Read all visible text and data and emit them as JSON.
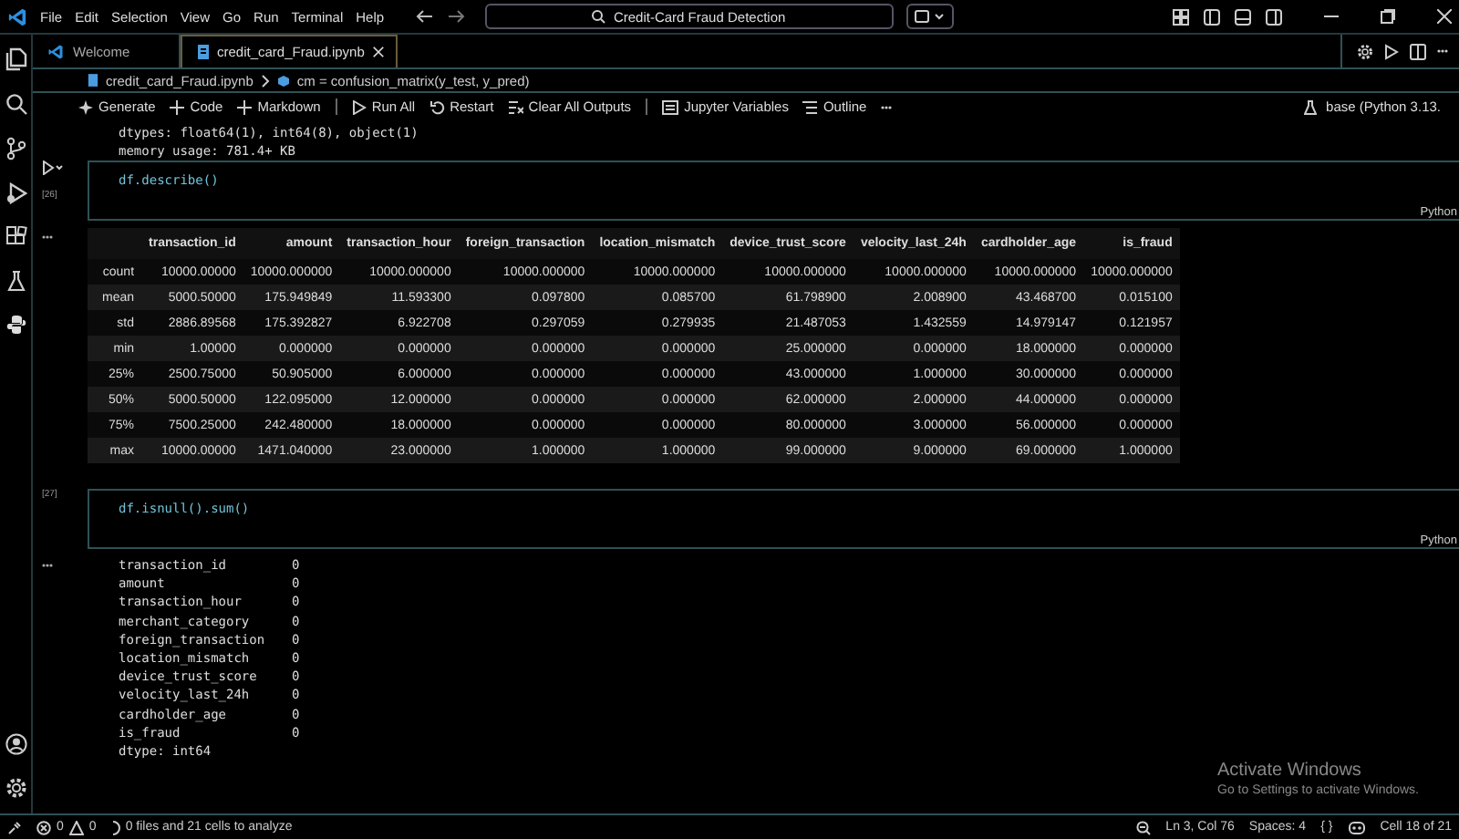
{
  "title_bar": {
    "menus": [
      "File",
      "Edit",
      "Selection",
      "View",
      "Go",
      "Run",
      "Terminal",
      "Help"
    ],
    "search": "Credit-Card Fraud Detection"
  },
  "tabs": [
    {
      "label": "Welcome",
      "kind": "welcome",
      "selected": false
    },
    {
      "label": "credit_card_Fraud.ipynb",
      "kind": "notebook",
      "selected": true
    }
  ],
  "breadcrumb": [
    "credit_card_Fraud.ipynb",
    "cm = confusion_matrix(y_test, y_pred)"
  ],
  "toolbar": [
    {
      "label": "Generate",
      "kind": "sparkle"
    },
    {
      "label": "Code",
      "kind": "plus"
    },
    {
      "label": "Markdown",
      "kind": "plus"
    },
    {
      "label": "Run All",
      "kind": "run"
    },
    {
      "label": "Restart",
      "kind": "restart"
    },
    {
      "label": "Clear All Outputs",
      "kind": "clear"
    },
    {
      "label": "Jupyter Variables",
      "kind": "variables"
    },
    {
      "label": "Outline",
      "kind": "outline"
    }
  ],
  "kernel": "base (Python 3.13.",
  "prev_output": [
    "dtypes: float64(1), int64(8), object(1)",
    "memory usage: 781.4+ KB"
  ],
  "cells": [
    {
      "code": "df.describe()",
      "count": "[26]",
      "language": "Python",
      "output": {
        "kind": "table",
        "columns": [
          "",
          "transaction_id",
          "amount",
          "transaction_hour",
          "foreign_transaction",
          "location_mismatch",
          "device_trust_score",
          "velocity_last_24h",
          "cardholder_age",
          "is_fraud"
        ],
        "rows": [
          [
            "count",
            "10000.00000",
            "10000.000000",
            "10000.000000",
            "10000.000000",
            "10000.000000",
            "10000.000000",
            "10000.000000",
            "10000.000000",
            "10000.000000"
          ],
          [
            "mean",
            "5000.50000",
            "175.949849",
            "11.593300",
            "0.097800",
            "0.085700",
            "61.798900",
            "2.008900",
            "43.468700",
            "0.015100"
          ],
          [
            "std",
            "2886.89568",
            "175.392827",
            "6.922708",
            "0.297059",
            "0.279935",
            "21.487053",
            "1.432559",
            "14.979147",
            "0.121957"
          ],
          [
            "min",
            "1.00000",
            "0.000000",
            "0.000000",
            "0.000000",
            "0.000000",
            "25.000000",
            "0.000000",
            "18.000000",
            "0.000000"
          ],
          [
            "25%",
            "2500.75000",
            "50.905000",
            "6.000000",
            "0.000000",
            "0.000000",
            "43.000000",
            "1.000000",
            "30.000000",
            "0.000000"
          ],
          [
            "50%",
            "5000.50000",
            "122.095000",
            "12.000000",
            "0.000000",
            "0.000000",
            "62.000000",
            "2.000000",
            "44.000000",
            "0.000000"
          ],
          [
            "75%",
            "7500.25000",
            "242.480000",
            "18.000000",
            "0.000000",
            "0.000000",
            "80.000000",
            "3.000000",
            "56.000000",
            "0.000000"
          ],
          [
            "max",
            "10000.00000",
            "1471.040000",
            "23.000000",
            "1.000000",
            "1.000000",
            "99.000000",
            "9.000000",
            "69.000000",
            "1.000000"
          ]
        ]
      }
    },
    {
      "code": "df.isnull().sum()",
      "count": "[27]",
      "language": "Python",
      "output": {
        "kind": "series",
        "rows": [
          [
            "transaction_id",
            "0"
          ],
          [
            "amount",
            "0"
          ],
          [
            "transaction_hour",
            "0"
          ],
          [
            "merchant_category",
            "0"
          ],
          [
            "foreign_transaction",
            "0"
          ],
          [
            "location_mismatch",
            "0"
          ],
          [
            "device_trust_score",
            "0"
          ],
          [
            "velocity_last_24h",
            "0"
          ],
          [
            "cardholder_age",
            "0"
          ],
          [
            "is_fraud",
            "0"
          ]
        ],
        "footer": "dtype: int64"
      }
    }
  ],
  "status_bar": {
    "errors": "0",
    "warnings": "0",
    "analysis": "0 files and 21 cells to analyze",
    "position": "Ln 3, Col 76",
    "spaces": "Spaces: 4",
    "braces": "{ }",
    "cell": "Cell 18 of 21"
  },
  "activation_notice": {
    "title": "Activate Windows",
    "message": "Go to Settings to activate Windows."
  }
}
